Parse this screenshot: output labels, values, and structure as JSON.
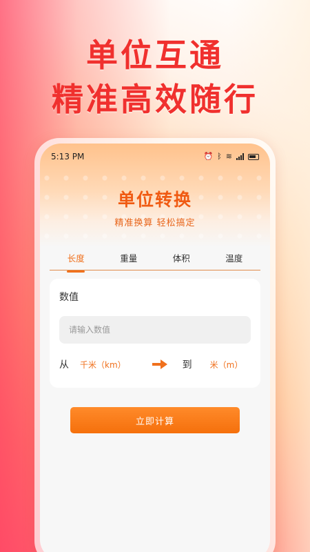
{
  "promo": {
    "line1": "单位互通",
    "line2": "精准高效随行"
  },
  "status_bar": {
    "time": "5:13 PM",
    "icons": [
      "alarm-icon",
      "bluetooth-icon",
      "wifi-icon",
      "signal-icon",
      "battery-icon"
    ]
  },
  "header": {
    "title": "单位转换",
    "subtitle": "精准换算 轻松搞定"
  },
  "tabs": [
    {
      "label": "长度",
      "active": true
    },
    {
      "label": "重量",
      "active": false
    },
    {
      "label": "体积",
      "active": false
    },
    {
      "label": "温度",
      "active": false
    }
  ],
  "form": {
    "value_label": "数值",
    "input_placeholder": "请输入数值",
    "from_label": "从",
    "from_unit": "千米（km）",
    "to_label": "到",
    "to_unit": "米（m）"
  },
  "actions": {
    "calculate_label": "立即计算"
  },
  "colors": {
    "accent": "#f0701c",
    "headline": "#f0302e"
  }
}
